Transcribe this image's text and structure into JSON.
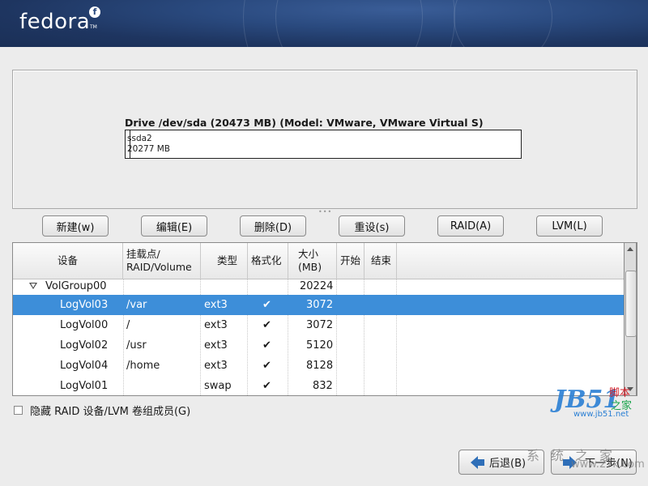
{
  "banner": {
    "logo_text": "fedora",
    "logo_mark": "f",
    "tm": "TM"
  },
  "drive": {
    "title": "Drive /dev/sda (20473 MB) (Model: VMware, VMware Virtual S)",
    "partition_name": "ssda2",
    "partition_size": "20277 MB"
  },
  "toolbar": {
    "new": "新建(w)",
    "edit": "编辑(E)",
    "delete": "删除(D)",
    "reset": "重设(s)",
    "raid": "RAID(A)",
    "lvm": "LVM(L)"
  },
  "table": {
    "columns": [
      "设备",
      "挂载点/\nRAID/Volume",
      "类型",
      "格式化",
      "大小\n(MB)",
      "开始",
      "结束"
    ],
    "group": {
      "name": "VolGroup00",
      "size": "20224"
    },
    "rows": [
      {
        "device": "LogVol03",
        "mount": "/var",
        "type": "ext3",
        "format": "✔",
        "size": "3072",
        "selected": true
      },
      {
        "device": "LogVol00",
        "mount": "/",
        "type": "ext3",
        "format": "✔",
        "size": "3072",
        "selected": false
      },
      {
        "device": "LogVol02",
        "mount": "/usr",
        "type": "ext3",
        "format": "✔",
        "size": "5120",
        "selected": false
      },
      {
        "device": "LogVol04",
        "mount": "/home",
        "type": "ext3",
        "format": "✔",
        "size": "8128",
        "selected": false
      },
      {
        "device": "LogVol01",
        "mount": "",
        "type": "swap",
        "format": "✔",
        "size": "832",
        "selected": false
      }
    ]
  },
  "hide_raid_label": "隐藏 RAID 设备/LVM 卷组成员(G)",
  "nav": {
    "back": "后退(B)",
    "next": "下一步(N)"
  },
  "watermark": {
    "jb": "JB51",
    "jb_top": "脚本",
    "jb_bottom": "之家",
    "url": "www.jb51.net",
    "sys": "系统之家",
    "url2": "www.27k.com"
  },
  "colors": {
    "selection": "#3d8ed9",
    "banner": "#1e3560",
    "accent": "#2f6fb8"
  }
}
